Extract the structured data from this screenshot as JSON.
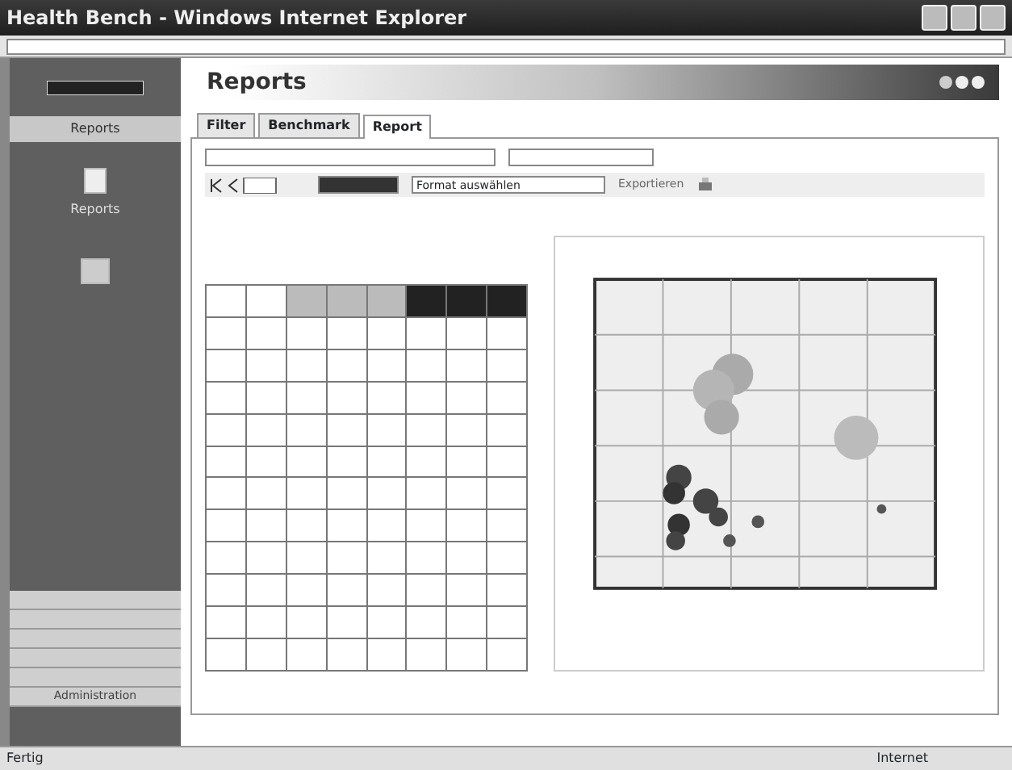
{
  "window": {
    "title": "Health Bench - Windows Internet Explorer"
  },
  "sidebar": {
    "section": "Reports",
    "items": [
      {
        "label": "Reports",
        "kind": "report"
      },
      {
        "kind": "folder"
      }
    ],
    "footer_items": [
      {
        "kind": "blank"
      },
      {
        "kind": "blank"
      },
      {
        "kind": "blank"
      },
      {
        "kind": "blank"
      },
      {
        "kind": "blank"
      },
      {
        "label": "Administration",
        "kind": "text"
      }
    ]
  },
  "header": {
    "title": "Reports"
  },
  "tabs": [
    {
      "label": "Filter",
      "selected": false
    },
    {
      "label": "Benchmark",
      "selected": false
    },
    {
      "label": "Report",
      "selected": true
    }
  ],
  "toolbar": {
    "format": "Format auswählen",
    "export": "Exportieren"
  },
  "status_bar": {
    "left": "Fertig",
    "zone": "Internet"
  }
}
